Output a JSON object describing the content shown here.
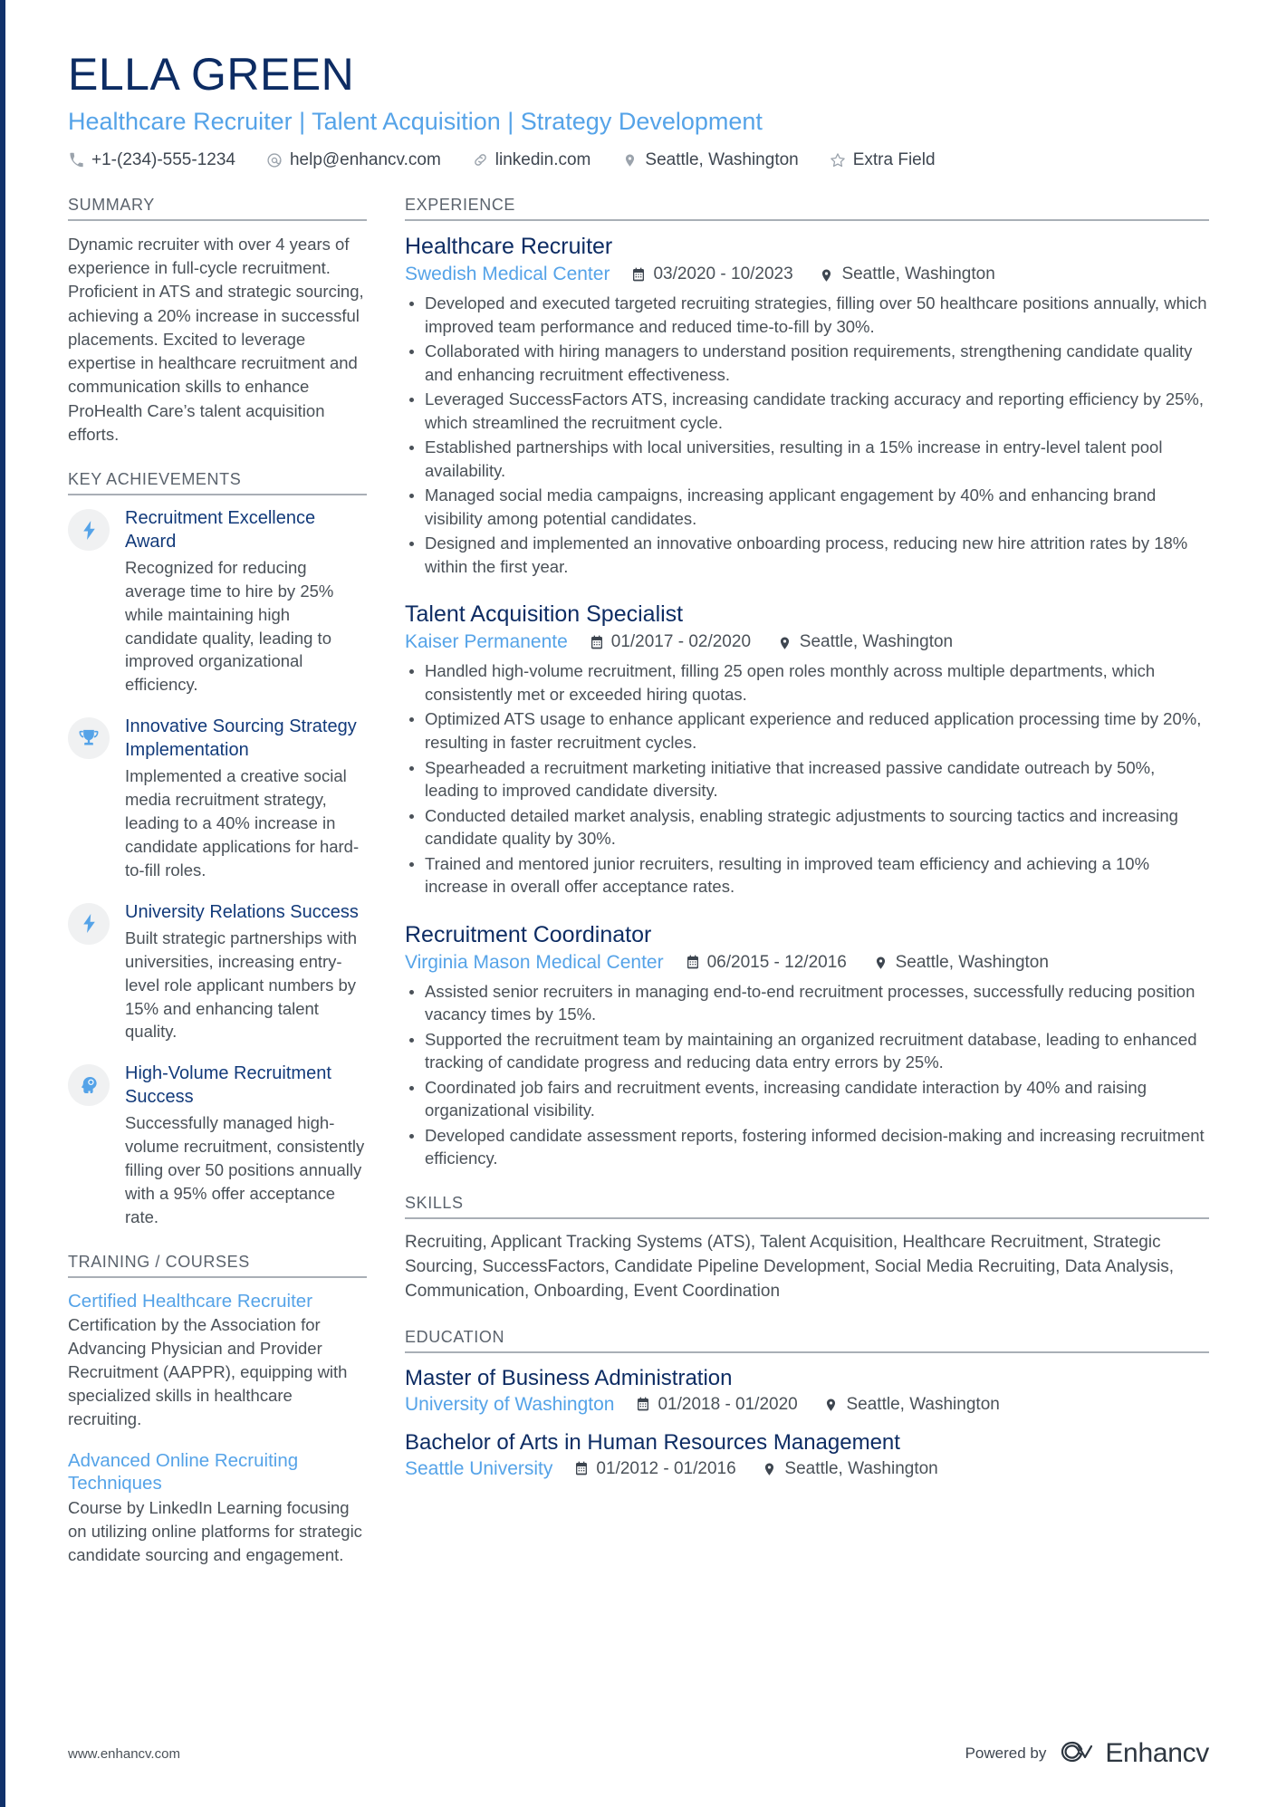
{
  "header": {
    "name": "ELLA GREEN",
    "title": "Healthcare Recruiter | Talent Acquisition | Strategy Development",
    "contacts": [
      {
        "icon": "phone-icon",
        "text": "+1-(234)-555-1234"
      },
      {
        "icon": "email-icon",
        "text": "help@enhancv.com"
      },
      {
        "icon": "link-icon",
        "text": "linkedin.com"
      },
      {
        "icon": "location-icon",
        "text": "Seattle, Washington"
      },
      {
        "icon": "star-icon",
        "text": "Extra Field"
      }
    ]
  },
  "summary": {
    "heading": "SUMMARY",
    "text": "Dynamic recruiter with over 4 years of experience in full-cycle recruitment. Proficient in ATS and strategic sourcing, achieving a 20% increase in successful placements. Excited to leverage expertise in healthcare recruitment and communication skills to enhance ProHealth Care’s talent acquisition efforts."
  },
  "key_achievements": {
    "heading": "KEY ACHIEVEMENTS",
    "items": [
      {
        "icon": "lightning-bolt-icon",
        "title": "Recruitment Excellence Award",
        "description": "Recognized for reducing average time to hire by 25% while maintaining high candidate quality, leading to improved organizational efficiency."
      },
      {
        "icon": "trophy-icon",
        "title": "Innovative Sourcing Strategy Implementation",
        "description": "Implemented a creative social media recruitment strategy, leading to a 40% increase in candidate applications for hard-to-fill roles."
      },
      {
        "icon": "lightning-bolt-icon",
        "title": "University Relations Success",
        "description": "Built strategic partnerships with universities, increasing entry-level role applicant numbers by 15% and enhancing talent quality."
      },
      {
        "icon": "head-profile-icon",
        "title": "High-Volume Recruitment Success",
        "description": "Successfully managed high-volume recruitment, consistently filling over 50 positions annually with a 95% offer acceptance rate."
      }
    ]
  },
  "training": {
    "heading": "TRAINING / COURSES",
    "items": [
      {
        "title": "Certified Healthcare Recruiter",
        "description": "Certification by the Association for Advancing Physician and Provider Recruitment (AAPPR), equipping with specialized skills in healthcare recruiting."
      },
      {
        "title": "Advanced Online Recruiting Techniques",
        "description": "Course by LinkedIn Learning focusing on utilizing online platforms for strategic candidate sourcing and engagement."
      }
    ]
  },
  "experience": {
    "heading": "EXPERIENCE",
    "jobs": [
      {
        "role": "Healthcare Recruiter",
        "company": "Swedish Medical Center",
        "date": "03/2020 - 10/2023",
        "location": "Seattle, Washington",
        "bullets": [
          "Developed and executed targeted recruiting strategies, filling over 50 healthcare positions annually, which improved team performance and reduced time-to-fill by 30%.",
          "Collaborated with hiring managers to understand position requirements, strengthening candidate quality and enhancing recruitment effectiveness.",
          "Leveraged SuccessFactors ATS, increasing candidate tracking accuracy and reporting efficiency by 25%, which streamlined the recruitment cycle.",
          "Established partnerships with local universities, resulting in a 15% increase in entry-level talent pool availability.",
          "Managed social media campaigns, increasing applicant engagement by 40% and enhancing brand visibility among potential candidates.",
          "Designed and implemented an innovative onboarding process, reducing new hire attrition rates by 18% within the first year."
        ]
      },
      {
        "role": "Talent Acquisition Specialist",
        "company": "Kaiser Permanente",
        "date": "01/2017 - 02/2020",
        "location": "Seattle, Washington",
        "bullets": [
          "Handled high-volume recruitment, filling 25 open roles monthly across multiple departments, which consistently met or exceeded hiring quotas.",
          "Optimized ATS usage to enhance applicant experience and reduced application processing time by 20%, resulting in faster recruitment cycles.",
          "Spearheaded a recruitment marketing initiative that increased passive candidate outreach by 50%, leading to improved candidate diversity.",
          "Conducted detailed market analysis, enabling strategic adjustments to sourcing tactics and increasing candidate quality by 30%.",
          "Trained and mentored junior recruiters, resulting in improved team efficiency and achieving a 10% increase in overall offer acceptance rates."
        ]
      },
      {
        "role": "Recruitment Coordinator",
        "company": "Virginia Mason Medical Center",
        "date": "06/2015 - 12/2016",
        "location": "Seattle, Washington",
        "bullets": [
          "Assisted senior recruiters in managing end-to-end recruitment processes, successfully reducing position vacancy times by 15%.",
          "Supported the recruitment team by maintaining an organized recruitment database, leading to enhanced tracking of candidate progress and reducing data entry errors by 25%.",
          "Coordinated job fairs and recruitment events, increasing candidate interaction by 40% and raising organizational visibility.",
          "Developed candidate assessment reports, fostering informed decision-making and increasing recruitment efficiency."
        ]
      }
    ]
  },
  "skills": {
    "heading": "SKILLS",
    "text": "Recruiting, Applicant Tracking Systems (ATS), Talent Acquisition, Healthcare Recruitment, Strategic Sourcing, SuccessFactors, Candidate Pipeline Development, Social Media Recruiting, Data Analysis, Communication, Onboarding, Event Coordination"
  },
  "education": {
    "heading": "EDUCATION",
    "items": [
      {
        "degree": "Master of Business Administration",
        "school": "University of Washington",
        "date": "01/2018 - 01/2020",
        "location": "Seattle, Washington"
      },
      {
        "degree": "Bachelor of Arts in Human Resources Management",
        "school": "Seattle University",
        "date": "01/2012 - 01/2016",
        "location": "Seattle, Washington"
      }
    ]
  },
  "footer": {
    "url": "www.enhancv.com",
    "powered_by": "Powered by",
    "brand": "Enhancv"
  },
  "colors": {
    "navy": "#0d2c63",
    "accent_blue": "#55a3e8",
    "body_text": "#4a5158",
    "rule": "#a9afb6",
    "left_bar": "#10316b"
  }
}
